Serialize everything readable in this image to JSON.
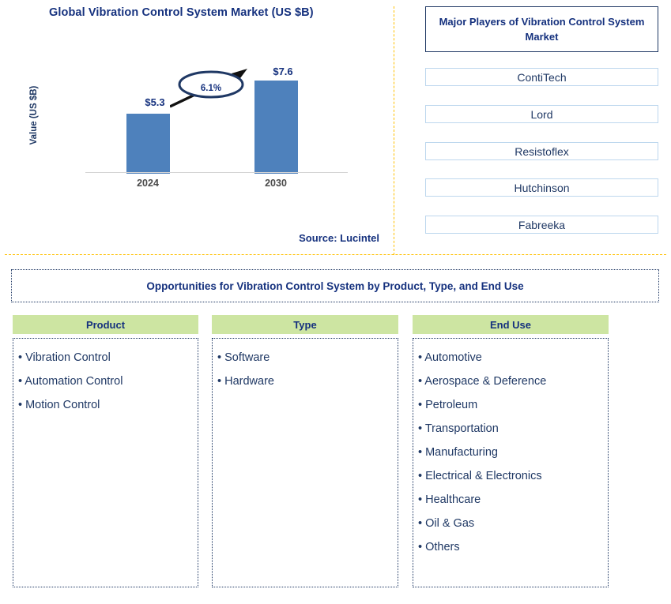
{
  "chart_panel": {
    "title": "Global Vibration Control System Market (US $B)",
    "y_axis_label": "Value (US $B)",
    "source": "Source: Lucintel",
    "cagr_label": "6.1%"
  },
  "chart_data": {
    "type": "bar",
    "title": "Global Vibration Control System Market (US $B)",
    "xlabel": "",
    "ylabel": "Value (US $B)",
    "categories": [
      "2024",
      "2030"
    ],
    "values": [
      5.3,
      7.6
    ],
    "value_labels": [
      "$5.3",
      "$7.6"
    ],
    "ylim": [
      0,
      8.6
    ],
    "grid": false,
    "legend": "none",
    "bar_color": "#4E81BC",
    "annotations": [
      {
        "type": "cagr-ellipse-arrow",
        "text": "6.1%",
        "from": "2024",
        "to": "2030"
      }
    ],
    "source": "Source: Lucintel"
  },
  "players_panel": {
    "title": "Major Players of Vibration Control System Market",
    "items": [
      {
        "label": "ContiTech"
      },
      {
        "label": "Lord"
      },
      {
        "label": "Resistoflex"
      },
      {
        "label": "Hutchinson"
      },
      {
        "label": "Fabreeka"
      }
    ]
  },
  "opportunities": {
    "title": "Opportunities for Vibration Control System by Product, Type, and End Use",
    "columns": [
      {
        "header": "Product",
        "items": [
          "• Vibration Control",
          "• Automation Control",
          "• Motion Control"
        ]
      },
      {
        "header": "Type",
        "items": [
          "• Software",
          "• Hardware"
        ]
      },
      {
        "header": "End Use",
        "items": [
          "• Automotive",
          "• Aerospace & Deference",
          "• Petroleum",
          "• Transportation",
          "• Manufacturing",
          "• Electrical & Electronics",
          "• Healthcare",
          "• Oil & Gas",
          "• Others"
        ]
      }
    ]
  },
  "colors": {
    "bar_blue": "#4E81BC",
    "navy_text": "#15317E",
    "divider_orange": "#FFC000",
    "header_green": "#CDE5A2",
    "player_border_blue": "#BDD7EE"
  }
}
